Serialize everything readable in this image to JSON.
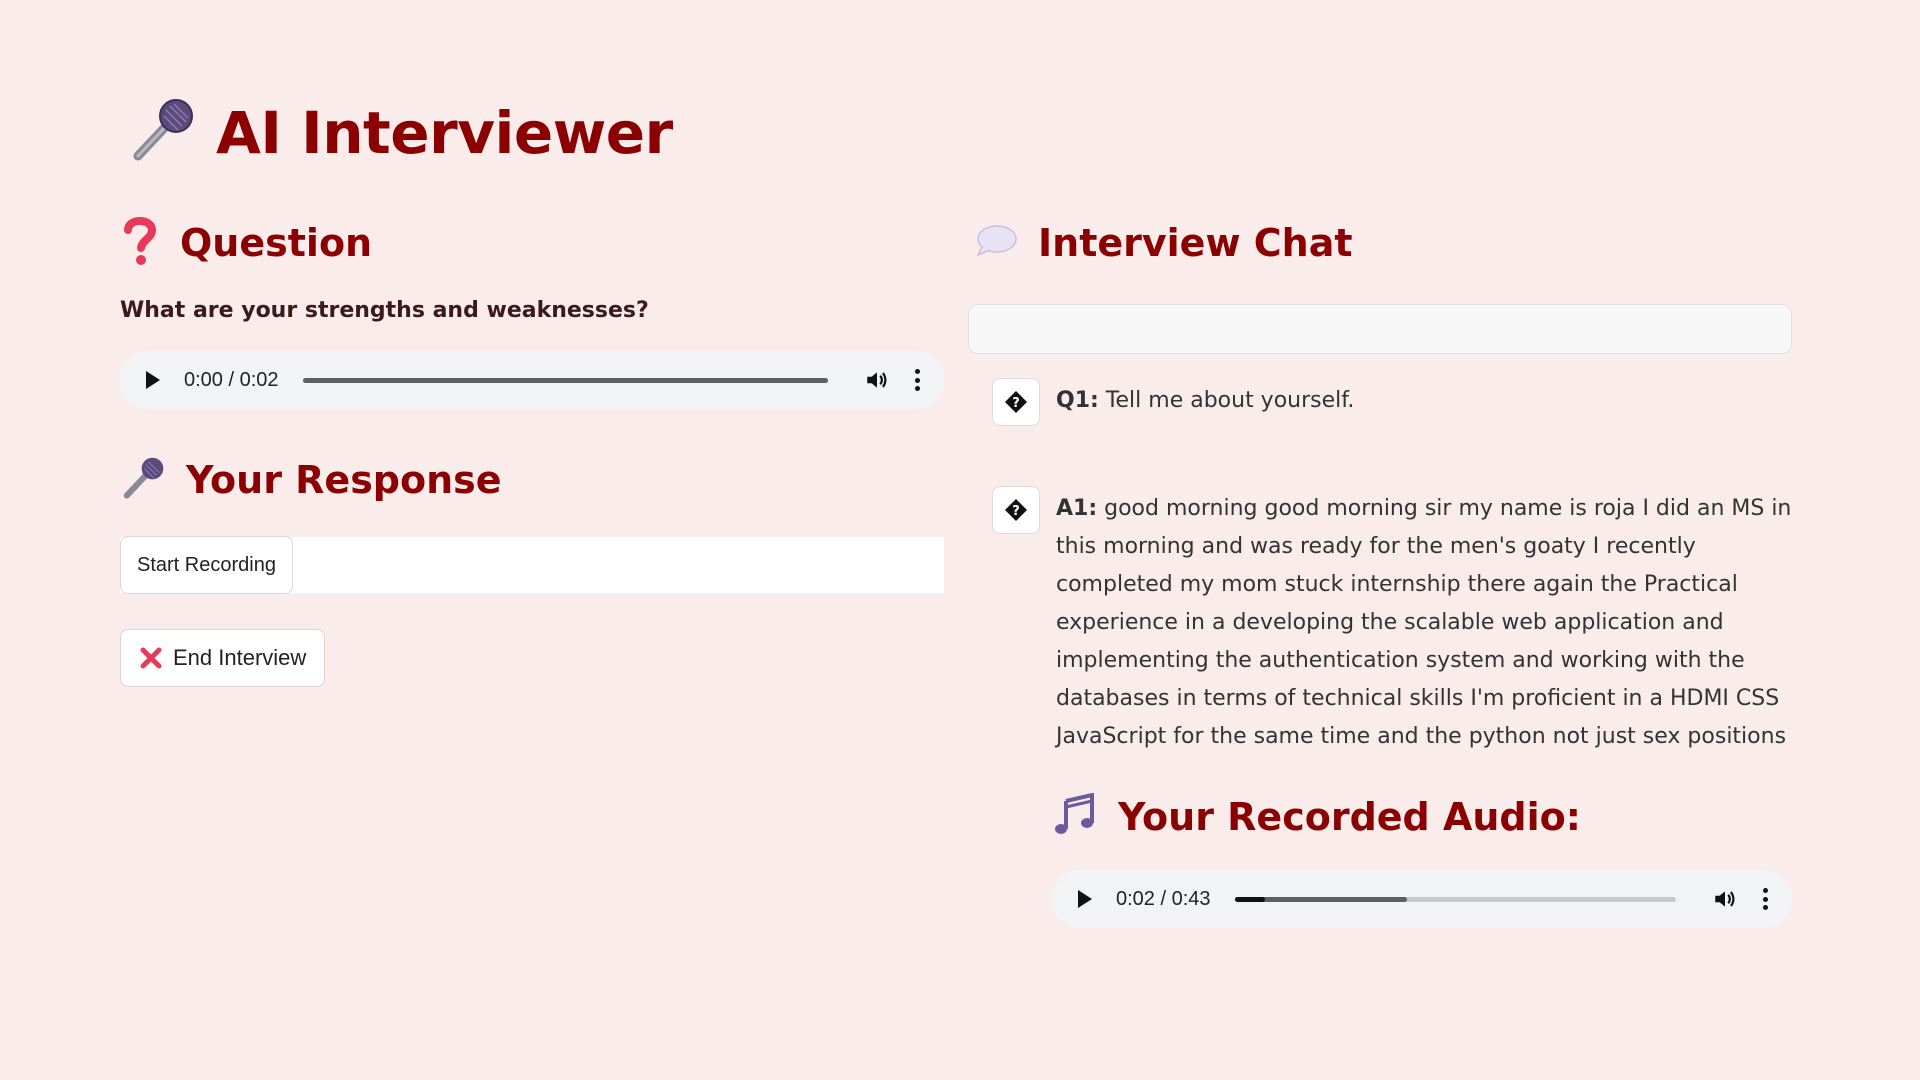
{
  "app": {
    "title": "AI Interviewer",
    "title_icon": "microphone-icon"
  },
  "question_section": {
    "heading": "Question",
    "heading_icon": "question-mark-icon",
    "text": "What are your strengths and weaknesses?",
    "audio": {
      "time": "0:00 / 0:02",
      "progress": 0.0
    }
  },
  "response_section": {
    "heading": "Your Response",
    "heading_icon": "microphone-icon",
    "record_button": "Start Recording",
    "end_button": "End Interview",
    "end_icon": "cross-mark-icon"
  },
  "chat_section": {
    "heading": "Interview Chat",
    "heading_icon": "speech-bubble-icon",
    "messages": [
      {
        "prefix": "Q1:",
        "text": " Tell me about yourself.",
        "avatar_icon": "unknown-glyph-icon"
      },
      {
        "prefix": "A1:",
        "text": " good morning good morning sir my name is roja I did an MS in this morning and was ready for the men's goaty I recently completed my mom stuck internship there again the Practical experience in a developing the scalable web application and implementing the authentication system and working with the databases in terms of technical skills I'm proficient in a HDMI CSS JavaScript for the same time and the python not just sex positions",
        "avatar_icon": "unknown-glyph-icon"
      }
    ],
    "recorded_heading": "Your Recorded Audio:",
    "recorded_icon": "music-notes-icon",
    "recorded_audio": {
      "time": "0:02 / 0:43",
      "progress": 0.07,
      "buffered": 0.39
    }
  },
  "colors": {
    "background": "#f9ecea",
    "heading": "#8b0000"
  }
}
